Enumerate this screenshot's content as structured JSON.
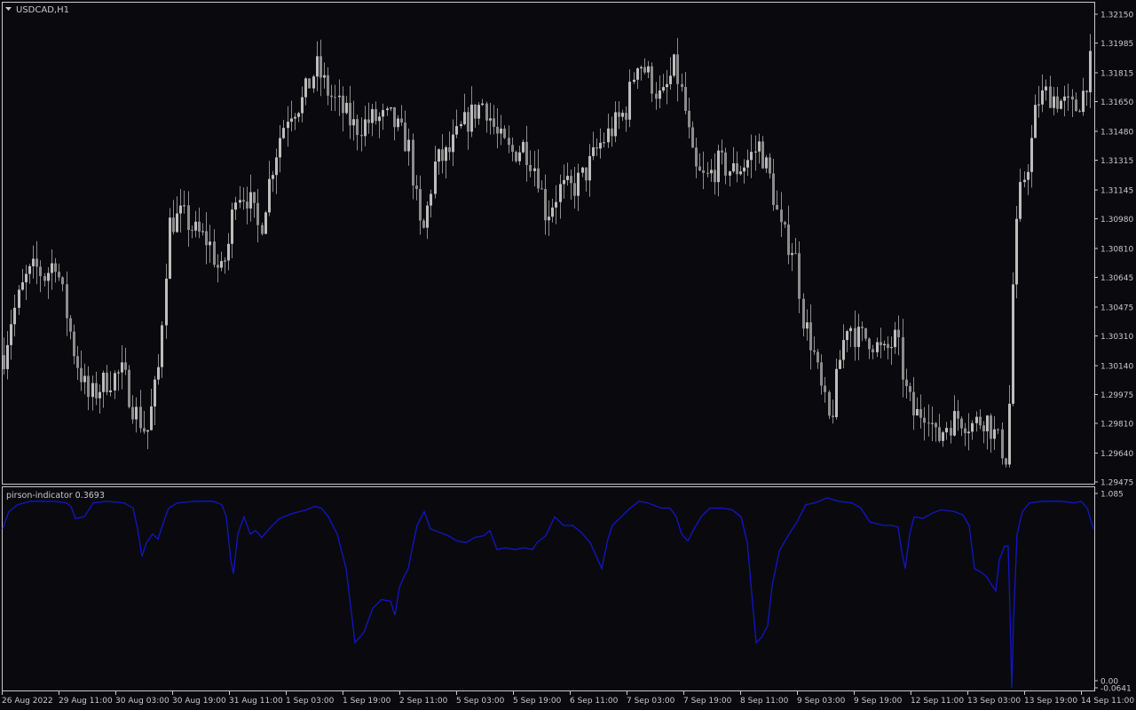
{
  "colors": {
    "background": "#0a0a0e",
    "frame": "#c8c8c8",
    "candle": "#8c8c8c",
    "candle_bright": "#bdbdbd",
    "indicator_line": "#1414c8",
    "text": "#c8c8c8"
  },
  "chart_data": [
    {
      "type": "candlestick",
      "title": "USDCAD,H1",
      "symbol": "USDCAD",
      "timeframe": "H1",
      "grid": false,
      "ylim": [
        1.29475,
        1.3225
      ],
      "y_ticks": [
        "1.32150",
        "1.31985",
        "1.31815",
        "1.31650",
        "1.31480",
        "1.31315",
        "1.31145",
        "1.30980",
        "1.30810",
        "1.30645",
        "1.30475",
        "1.30310",
        "1.30140",
        "1.29975",
        "1.29810",
        "1.29640",
        "1.29475"
      ],
      "anchors": [
        [
          0,
          1.301
        ],
        [
          12,
          1.304
        ],
        [
          28,
          1.3063
        ],
        [
          40,
          1.307
        ],
        [
          50,
          1.3065
        ],
        [
          62,
          1.3075
        ],
        [
          72,
          1.305
        ],
        [
          84,
          1.302
        ],
        [
          100,
          1.2995
        ],
        [
          118,
          1.3005
        ],
        [
          138,
          1.301
        ],
        [
          150,
          1.299
        ],
        [
          165,
          1.2975
        ],
        [
          178,
          1.301
        ],
        [
          190,
          1.3095
        ],
        [
          205,
          1.31
        ],
        [
          220,
          1.309
        ],
        [
          235,
          1.3085
        ],
        [
          248,
          1.3065
        ],
        [
          258,
          1.3085
        ],
        [
          265,
          1.3115
        ],
        [
          280,
          1.311
        ],
        [
          292,
          1.309
        ],
        [
          305,
          1.3125
        ],
        [
          315,
          1.3145
        ],
        [
          325,
          1.316
        ],
        [
          340,
          1.3165
        ],
        [
          356,
          1.3185
        ],
        [
          370,
          1.317
        ],
        [
          385,
          1.316
        ],
        [
          400,
          1.315
        ],
        [
          420,
          1.3155
        ],
        [
          440,
          1.3155
        ],
        [
          460,
          1.314
        ],
        [
          475,
          1.3085
        ],
        [
          490,
          1.313
        ],
        [
          505,
          1.3135
        ],
        [
          520,
          1.315
        ],
        [
          535,
          1.316
        ],
        [
          545,
          1.3165
        ],
        [
          560,
          1.3145
        ],
        [
          575,
          1.3135
        ],
        [
          590,
          1.314
        ],
        [
          605,
          1.3125
        ],
        [
          615,
          1.31
        ],
        [
          630,
          1.3115
        ],
        [
          645,
          1.3115
        ],
        [
          660,
          1.3125
        ],
        [
          675,
          1.314
        ],
        [
          690,
          1.315
        ],
        [
          705,
          1.316
        ],
        [
          718,
          1.319
        ],
        [
          730,
          1.318
        ],
        [
          745,
          1.3165
        ],
        [
          760,
          1.3185
        ],
        [
          770,
          1.3165
        ],
        [
          782,
          1.3125
        ],
        [
          795,
          1.312
        ],
        [
          810,
          1.313
        ],
        [
          825,
          1.3125
        ],
        [
          840,
          1.313
        ],
        [
          855,
          1.314
        ],
        [
          868,
          1.312
        ],
        [
          880,
          1.309
        ],
        [
          895,
          1.308
        ],
        [
          905,
          1.304
        ],
        [
          915,
          1.3025
        ],
        [
          925,
          1.3
        ],
        [
          935,
          1.298
        ],
        [
          945,
          1.3015
        ],
        [
          955,
          1.304
        ],
        [
          965,
          1.303
        ],
        [
          980,
          1.303
        ],
        [
          995,
          1.302
        ],
        [
          1010,
          1.303
        ],
        [
          1020,
          1.3
        ],
        [
          1030,
          1.2985
        ],
        [
          1045,
          1.299
        ],
        [
          1055,
          1.297
        ],
        [
          1065,
          1.298
        ],
        [
          1080,
          1.2985
        ],
        [
          1095,
          1.298
        ],
        [
          1110,
          1.2985
        ],
        [
          1125,
          1.297
        ],
        [
          1135,
          1.296
        ],
        [
          1142,
          1.3075
        ],
        [
          1150,
          1.3115
        ],
        [
          1160,
          1.3135
        ],
        [
          1168,
          1.3165
        ],
        [
          1180,
          1.317
        ],
        [
          1195,
          1.3165
        ],
        [
          1210,
          1.316
        ],
        [
          1220,
          1.317
        ],
        [
          1230,
          1.319
        ]
      ],
      "x_labels": [
        {
          "label": "26 Aug 2022",
          "at": 2
        },
        {
          "label": "29 Aug 11:00",
          "at": 66
        },
        {
          "label": "30 Aug 03:00",
          "at": 130
        },
        {
          "label": "30 Aug 19:00",
          "at": 194
        },
        {
          "label": "31 Aug 11:00",
          "at": 258
        },
        {
          "label": "1 Sep 03:00",
          "at": 322
        },
        {
          "label": "1 Sep 19:00",
          "at": 386
        },
        {
          "label": "2 Sep 11:00",
          "at": 450
        },
        {
          "label": "5 Sep 03:00",
          "at": 514
        },
        {
          "label": "5 Sep 19:00",
          "at": 578
        },
        {
          "label": "6 Sep 11:00",
          "at": 642
        },
        {
          "label": "7 Sep 03:00",
          "at": 706
        },
        {
          "label": "7 Sep 19:00",
          "at": 770
        },
        {
          "label": "8 Sep 11:00",
          "at": 834
        },
        {
          "label": "9 Sep 03:00",
          "at": 898
        },
        {
          "label": "9 Sep 19:00",
          "at": 962
        },
        {
          "label": "12 Sep 11:00",
          "at": 1026
        },
        {
          "label": "13 Sep 03:00",
          "at": 1090
        },
        {
          "label": "13 Sep 19:00",
          "at": 1154
        },
        {
          "label": "14 Sep 11:00",
          "at": 1218
        }
      ]
    },
    {
      "type": "line",
      "title": "pirson-indicator 0.3693",
      "grid": false,
      "ylim": [
        -0.0641,
        1.085
      ],
      "y_ticks": [
        "1.085",
        "0.00",
        "-0.0641"
      ],
      "series": [
        {
          "points": [
            [
              3,
              0.88
            ],
            [
              10,
              0.98
            ],
            [
              20,
              1.02
            ],
            [
              35,
              1.04
            ],
            [
              60,
              1.04
            ],
            [
              75,
              1.03
            ],
            [
              80,
              1.01
            ],
            [
              85,
              0.94
            ],
            [
              95,
              0.95
            ],
            [
              105,
              1.03
            ],
            [
              120,
              1.04
            ],
            [
              140,
              1.03
            ],
            [
              150,
              1.0
            ],
            [
              155,
              0.88
            ],
            [
              160,
              0.72
            ],
            [
              165,
              0.8
            ],
            [
              172,
              0.85
            ],
            [
              178,
              0.82
            ],
            [
              183,
              0.9
            ],
            [
              190,
              1.0
            ],
            [
              200,
              1.03
            ],
            [
              220,
              1.04
            ],
            [
              240,
              1.04
            ],
            [
              250,
              1.02
            ],
            [
              255,
              0.95
            ],
            [
              260,
              0.7
            ],
            [
              263,
              0.62
            ],
            [
              268,
              0.85
            ],
            [
              275,
              0.95
            ],
            [
              282,
              0.85
            ],
            [
              288,
              0.87
            ],
            [
              295,
              0.83
            ],
            [
              305,
              0.89
            ],
            [
              315,
              0.94
            ],
            [
              330,
              0.97
            ],
            [
              345,
              0.99
            ],
            [
              355,
              1.01
            ],
            [
              362,
              1.0
            ],
            [
              370,
              0.95
            ],
            [
              380,
              0.85
            ],
            [
              390,
              0.65
            ],
            [
              400,
              0.22
            ],
            [
              410,
              0.28
            ],
            [
              420,
              0.42
            ],
            [
              430,
              0.47
            ],
            [
              440,
              0.46
            ],
            [
              445,
              0.38
            ],
            [
              450,
              0.54
            ],
            [
              455,
              0.6
            ],
            [
              460,
              0.65
            ],
            [
              465,
              0.78
            ],
            [
              470,
              0.9
            ],
            [
              478,
              0.98
            ],
            [
              485,
              0.88
            ],
            [
              495,
              0.86
            ],
            [
              505,
              0.84
            ],
            [
              515,
              0.81
            ],
            [
              525,
              0.8
            ],
            [
              535,
              0.83
            ],
            [
              545,
              0.84
            ],
            [
              552,
              0.87
            ],
            [
              560,
              0.76
            ],
            [
              570,
              0.77
            ],
            [
              580,
              0.76
            ],
            [
              590,
              0.77
            ],
            [
              600,
              0.76
            ],
            [
              605,
              0.8
            ],
            [
              615,
              0.84
            ],
            [
              625,
              0.95
            ],
            [
              635,
              0.9
            ],
            [
              645,
              0.9
            ],
            [
              655,
              0.86
            ],
            [
              665,
              0.8
            ],
            [
              672,
              0.72
            ],
            [
              678,
              0.65
            ],
            [
              685,
              0.82
            ],
            [
              690,
              0.9
            ],
            [
              700,
              0.95
            ],
            [
              710,
              1.0
            ],
            [
              720,
              1.04
            ],
            [
              730,
              1.03
            ],
            [
              745,
              1.0
            ],
            [
              755,
              1.0
            ],
            [
              762,
              0.95
            ],
            [
              768,
              0.85
            ],
            [
              775,
              0.81
            ],
            [
              782,
              0.88
            ],
            [
              790,
              0.95
            ],
            [
              800,
              1.0
            ],
            [
              815,
              1.0
            ],
            [
              825,
              0.99
            ],
            [
              835,
              0.95
            ],
            [
              842,
              0.8
            ],
            [
              848,
              0.45
            ],
            [
              852,
              0.22
            ],
            [
              858,
              0.25
            ],
            [
              865,
              0.32
            ],
            [
              870,
              0.55
            ],
            [
              878,
              0.75
            ],
            [
              888,
              0.84
            ],
            [
              898,
              0.92
            ],
            [
              908,
              1.02
            ],
            [
              918,
              1.03
            ],
            [
              932,
              1.06
            ],
            [
              945,
              1.04
            ],
            [
              960,
              1.03
            ],
            [
              970,
              1.0
            ],
            [
              980,
              0.92
            ],
            [
              995,
              0.9
            ],
            [
              1005,
              0.9
            ],
            [
              1012,
              0.89
            ],
            [
              1016,
              0.75
            ],
            [
              1020,
              0.65
            ],
            [
              1025,
              0.85
            ],
            [
              1030,
              0.95
            ],
            [
              1040,
              0.94
            ],
            [
              1050,
              0.97
            ],
            [
              1060,
              0.99
            ],
            [
              1075,
              0.98
            ],
            [
              1085,
              0.96
            ],
            [
              1092,
              0.9
            ],
            [
              1098,
              0.65
            ],
            [
              1105,
              0.63
            ],
            [
              1112,
              0.6
            ],
            [
              1118,
              0.55
            ],
            [
              1122,
              0.52
            ],
            [
              1126,
              0.7
            ],
            [
              1132,
              0.78
            ],
            [
              1136,
              0.78
            ],
            [
              1138,
              0.4
            ],
            [
              1140,
              -0.04
            ],
            [
              1142,
              0.35
            ],
            [
              1146,
              0.85
            ],
            [
              1152,
              0.98
            ],
            [
              1160,
              1.03
            ],
            [
              1175,
              1.04
            ],
            [
              1195,
              1.04
            ],
            [
              1210,
              1.03
            ],
            [
              1218,
              1.04
            ],
            [
              1225,
              1.0
            ],
            [
              1232,
              0.88
            ]
          ]
        }
      ]
    }
  ]
}
